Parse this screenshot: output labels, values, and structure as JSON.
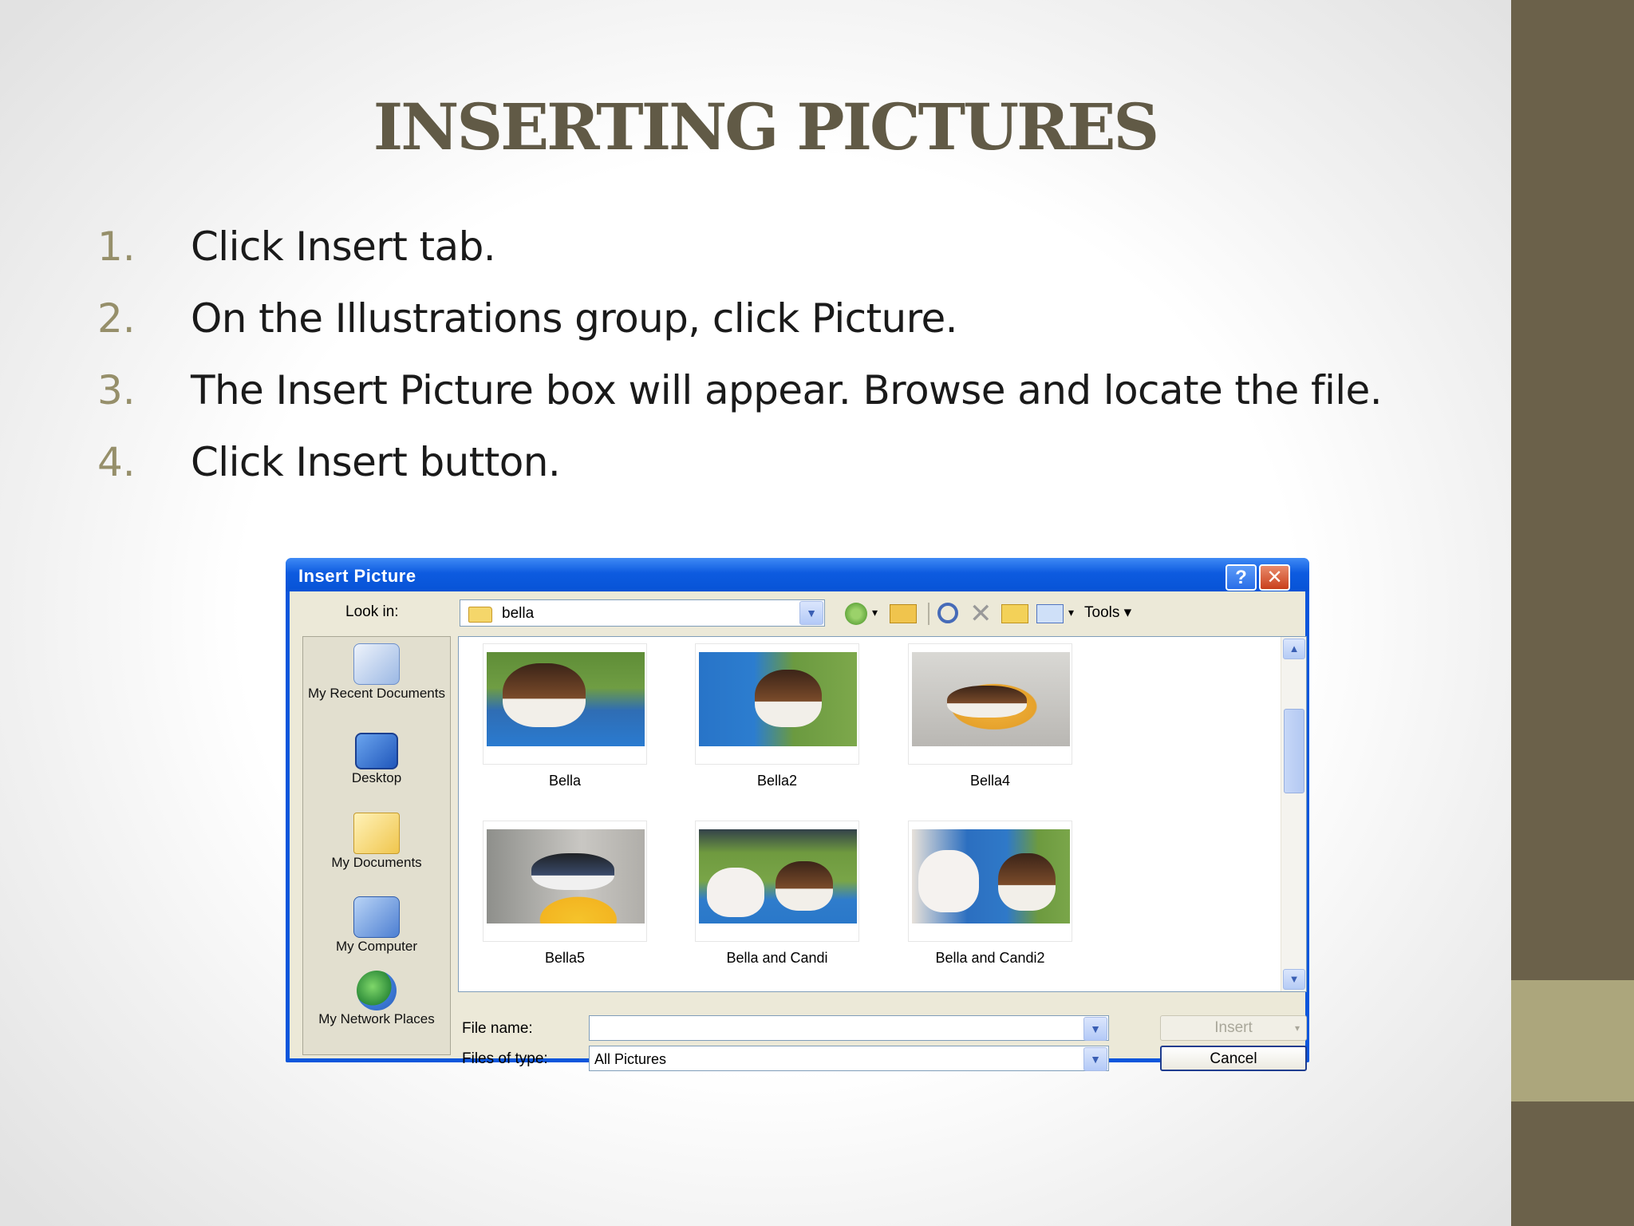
{
  "slide": {
    "title": "INSERTING PICTURES",
    "steps": [
      {
        "num": "1.",
        "text": "Click Insert tab."
      },
      {
        "num": "2.",
        "text": "On the Illustrations group, click Picture."
      },
      {
        "num": "3.",
        "text": "The Insert Picture box will appear. Browse and locate the file."
      },
      {
        "num": "4.",
        "text": "Click Insert button."
      }
    ]
  },
  "dialog": {
    "title": "Insert Picture",
    "help_label": "?",
    "close_label": "✕",
    "look_in_label": "Look in:",
    "look_in_value": "bella",
    "tools_label": "Tools ▾",
    "places": [
      {
        "label": "My Recent Documents",
        "icon": "recent-documents-icon"
      },
      {
        "label": "Desktop",
        "icon": "desktop-icon"
      },
      {
        "label": "My Documents",
        "icon": "my-documents-icon"
      },
      {
        "label": "My Computer",
        "icon": "my-computer-icon"
      },
      {
        "label": "My Network Places",
        "icon": "network-places-icon"
      }
    ],
    "files": [
      {
        "name": "Bella"
      },
      {
        "name": "Bella2"
      },
      {
        "name": "Bella4"
      },
      {
        "name": "Bella5"
      },
      {
        "name": "Bella and Candi"
      },
      {
        "name": "Bella and Candi2"
      }
    ],
    "file_name_label": "File name:",
    "file_name_value": "",
    "files_of_type_label": "Files of type:",
    "files_of_type_value": "All Pictures",
    "insert_label": "Insert",
    "cancel_label": "Cancel"
  },
  "colors": {
    "title": "#615a46",
    "step_number": "#968f6a",
    "side_bar": "#6b614a",
    "side_accent": "#aca67c",
    "dialog_frame": "#0a56dc"
  }
}
